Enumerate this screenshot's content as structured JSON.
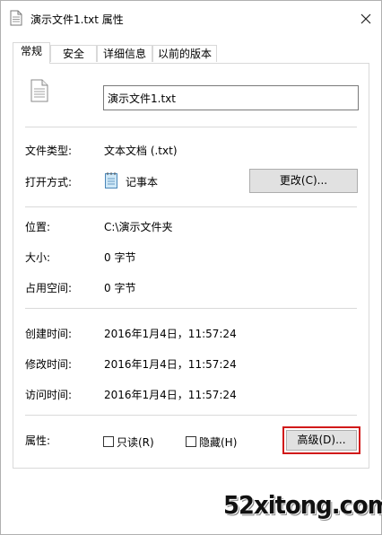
{
  "window": {
    "title": "演示文件1.txt 属性"
  },
  "tabs": [
    {
      "label": "常规",
      "active": true
    },
    {
      "label": "安全",
      "active": false
    },
    {
      "label": "详细信息",
      "active": false
    },
    {
      "label": "以前的版本",
      "active": false
    }
  ],
  "general": {
    "file_name": "演示文件1.txt",
    "type_label": "文件类型:",
    "type_value": "文本文档 (.txt)",
    "opens_with_label": "打开方式:",
    "opens_with_value": "记事本",
    "change_button": "更改(C)...",
    "location_label": "位置:",
    "location_value": "C:\\演示文件夹",
    "size_label": "大小:",
    "size_value": "0 字节",
    "size_on_disk_label": "占用空间:",
    "size_on_disk_value": "0 字节",
    "created_label": "创建时间:",
    "created_value": "2016年1月4日，11:57:24",
    "modified_label": "修改时间:",
    "modified_value": "2016年1月4日，11:57:24",
    "accessed_label": "访问时间:",
    "accessed_value": "2016年1月4日，11:57:24",
    "attributes_label": "属性:",
    "readonly_label": "只读(R)",
    "readonly_checked": false,
    "hidden_label": "隐藏(H)",
    "hidden_checked": false,
    "advanced_button": "高级(D)..."
  },
  "highlight_color": "#d11a1a",
  "watermark": "52xitong.com"
}
